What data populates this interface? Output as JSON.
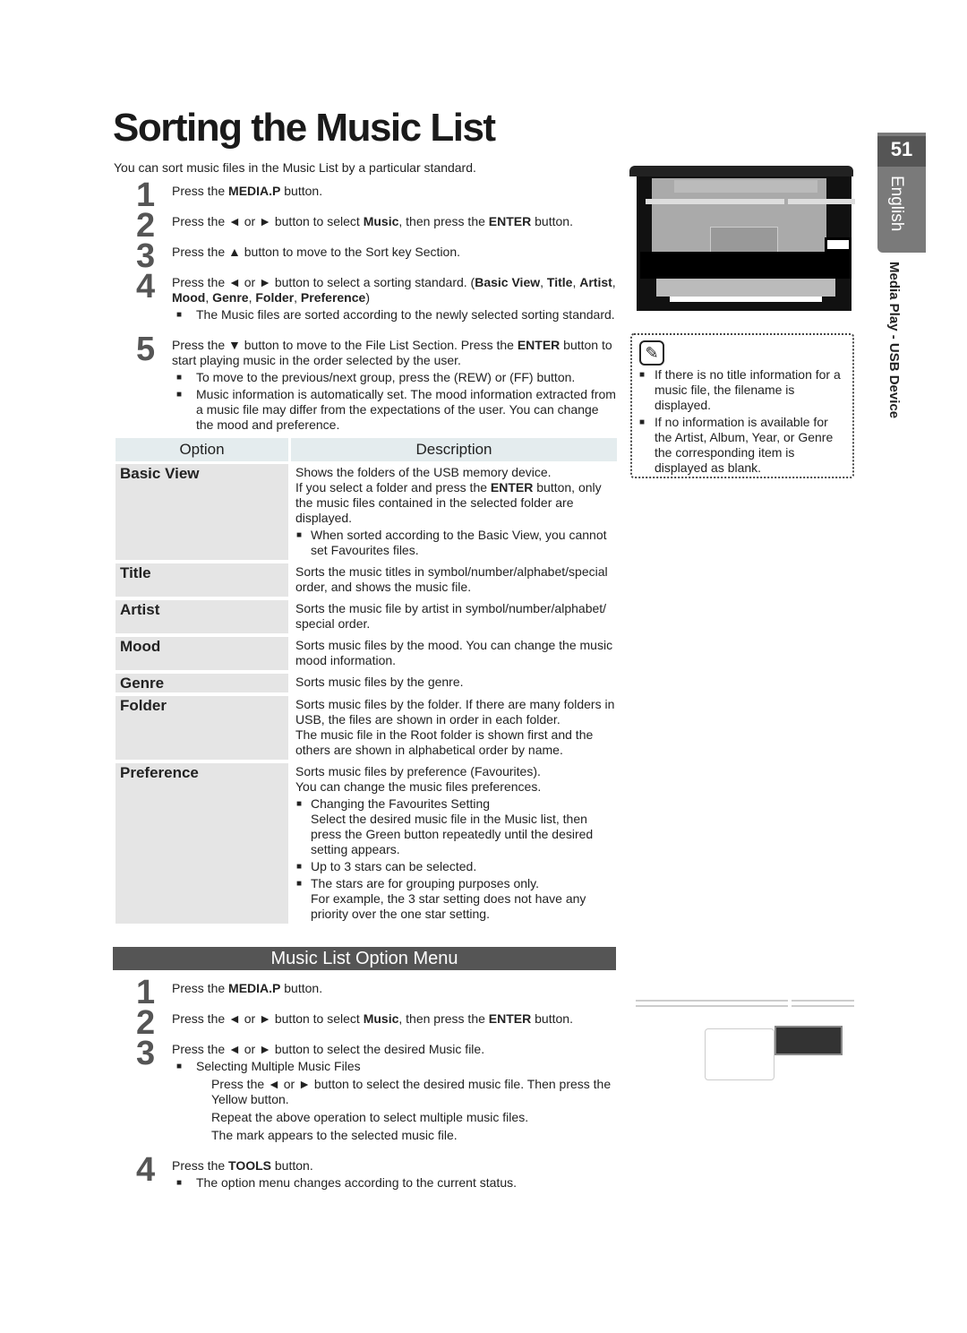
{
  "title": "Sorting the Music List",
  "intro": "You can sort music files in the Music List by a particular standard.",
  "steps_sort": [
    {
      "n": "1",
      "text": "Press the **MEDIA.P** button.",
      "bullets": []
    },
    {
      "n": "2",
      "text": "Press the ◄ or ► button to select **Music**, then press the **ENTER**      button.",
      "bullets": []
    },
    {
      "n": "3",
      "text": "Press the ▲ button to move to the Sort key Section.",
      "bullets": []
    },
    {
      "n": "4",
      "text": "Press the ◄ or ► button to select a sorting standard. (**Basic View**, **Title**, **Artist**, **Mood**, **Genre**, **Folder**, **Preference**)",
      "bullets": [
        "The Music files are sorted according to the newly selected sorting standard."
      ]
    },
    {
      "n": "5",
      "text": "Press the ▼ button to move to the File List Section. Press the **ENTER**      button to start playing music in the order selected by the user.",
      "bullets": [
        "To move to the previous/next group, press the       (REW) or       (FF) button.",
        "Music information is automatically set. The mood information extracted from a music file may differ from the expectations of the user. You can change the mood and preference."
      ]
    }
  ],
  "table": {
    "headers": [
      "Option",
      "Description"
    ],
    "rows": [
      {
        "option": "Basic View",
        "desc": [
          {
            "t": "p",
            "v": "Shows the folders of the USB memory device."
          },
          {
            "t": "p",
            "v": "If you select a folder and press the **ENTER**      button, only the music files contained in the selected folder are displayed."
          },
          {
            "t": "b",
            "v": "When sorted according to the Basic View, you cannot set Favourites files."
          }
        ]
      },
      {
        "option": "Title",
        "desc": [
          {
            "t": "p",
            "v": "Sorts the music titles in symbol/number/alphabet/special order, and shows the music file."
          }
        ]
      },
      {
        "option": "Artist",
        "desc": [
          {
            "t": "p",
            "v": "Sorts the music file by artist in symbol/number/alphabet/ special order."
          }
        ]
      },
      {
        "option": "Mood",
        "desc": [
          {
            "t": "p",
            "v": "Sorts music files by the mood. You can change the music mood information."
          }
        ]
      },
      {
        "option": "Genre",
        "desc": [
          {
            "t": "p",
            "v": "Sorts music files by the genre."
          }
        ]
      },
      {
        "option": "Folder",
        "desc": [
          {
            "t": "p",
            "v": "Sorts music files by the folder. If there are many folders in USB, the files are shown in order in each folder."
          },
          {
            "t": "p",
            "v": "The music file in the Root folder is shown first and the others are shown in alphabetical order by name."
          }
        ]
      },
      {
        "option": "Preference",
        "desc": [
          {
            "t": "p",
            "v": "Sorts music files by preference (Favourites)."
          },
          {
            "t": "p",
            "v": "You can change the music files preferences."
          },
          {
            "t": "b",
            "v": "Changing the Favourites Setting\nSelect the desired music file in the Music list, then press the Green button repeatedly until the desired setting appears."
          },
          {
            "t": "b",
            "v": "Up to 3 stars can be selected."
          },
          {
            "t": "b",
            "v": "The stars are for grouping purposes only.\nFor example, the 3 star setting does not have any priority over the one star setting."
          }
        ]
      }
    ]
  },
  "section_title": "Music List Option Menu",
  "steps_option": [
    {
      "n": "1",
      "text": "Press the **MEDIA.P** button.",
      "bullets": []
    },
    {
      "n": "2",
      "text": "Press the ◄ or ► button to select **Music**, then press the **ENTER**      button.",
      "bullets": []
    },
    {
      "n": "3",
      "text": "Press the ◄ or ► button to select the desired Music file.",
      "bullets": [
        "Selecting Multiple Music Files"
      ],
      "paras": [
        "Press the ◄ or ► button to select the desired music file. Then press the Yellow button.",
        "Repeat the above operation to select multiple music files.",
        "The mark       appears to the selected music file."
      ]
    },
    {
      "n": "4",
      "text": "Press the **TOOLS** button.",
      "bullets": [
        "The option menu changes according to the current status."
      ]
    }
  ],
  "note": {
    "icon": "note-pencil-icon",
    "items": [
      "If there is no title information for a music file, the filename is displayed.",
      "If no information is available for the Artist, Album, Year, or Genre the corresponding item is displayed as blank."
    ]
  },
  "sidebar": {
    "page_number": "51",
    "language": "English",
    "chapter": "Media Play - USB Device"
  }
}
